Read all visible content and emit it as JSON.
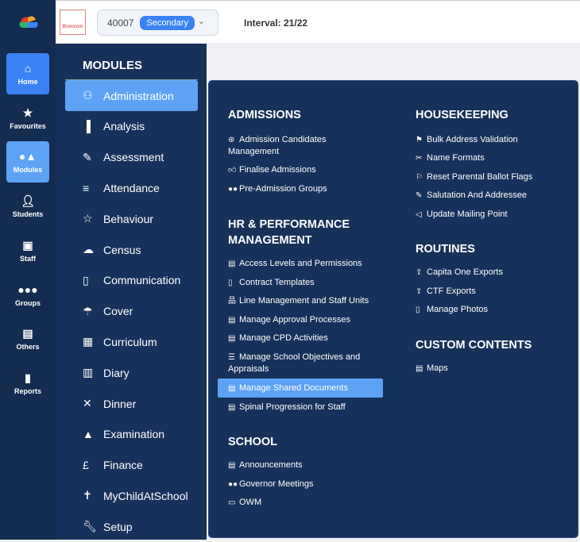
{
  "rail": [
    {
      "label": "Home",
      "icon": "home-icon"
    },
    {
      "label": "Favourites",
      "icon": "star-icon"
    },
    {
      "label": "Modules",
      "icon": "shapes-icon"
    },
    {
      "label": "Students",
      "icon": "user-icon"
    },
    {
      "label": "Staff",
      "icon": "staff-icon"
    },
    {
      "label": "Groups",
      "icon": "users-icon"
    },
    {
      "label": "Others",
      "icon": "others-icon"
    },
    {
      "label": "Reports",
      "icon": "file-icon"
    }
  ],
  "header": {
    "brand": "Bromcom",
    "school_id": "40007",
    "school_type": "Secondary",
    "interval": "Interval: 21/22"
  },
  "modules": {
    "title": "MODULES",
    "items": [
      "Administration",
      "Analysis",
      "Assessment",
      "Attendance",
      "Behaviour",
      "Census",
      "Communication",
      "Cover",
      "Curriculum",
      "Diary",
      "Dinner",
      "Examination",
      "Finance",
      "MyChildAtSchool",
      "Setup"
    ]
  },
  "flyout": {
    "admissions": {
      "title": "ADMISSIONS",
      "items": [
        "Admission Candidates Management",
        "Finalise Admissions",
        "Pre-Admission Groups"
      ]
    },
    "hr": {
      "title": "HR & PERFORMANCE MANAGEMENT",
      "items": [
        "Access Levels and Permissions",
        "Contract Templates",
        "Line Management and Staff Units",
        "Manage Approval Processes",
        "Manage CPD Activities",
        "Manage School Objectives and Appraisals",
        "Manage Shared Documents",
        "Spinal Progression for Staff"
      ]
    },
    "school": {
      "title": "SCHOOL",
      "items": [
        "Announcements",
        "Governor Meetings",
        "OWM"
      ]
    },
    "housekeeping": {
      "title": "HOUSEKEEPING",
      "items": [
        "Bulk Address Validation",
        "Name Formats",
        "Reset Parental Ballot Flags",
        "Salutation And Addressee",
        "Update Mailing Point"
      ]
    },
    "routines": {
      "title": "ROUTINES",
      "items": [
        "Capita One Exports",
        "CTF Exports",
        "Manage Photos"
      ]
    },
    "custom": {
      "title": "CUSTOM CONTENTS",
      "items": [
        "Maps"
      ]
    }
  },
  "colors": {
    "rail": "#132c50",
    "panel": "#17325a",
    "accent": "#3b82f6",
    "active": "#5ea2f5"
  }
}
